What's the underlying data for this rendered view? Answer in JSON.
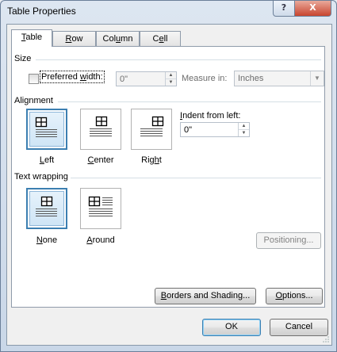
{
  "window": {
    "title": "Table Properties",
    "help_label": "?",
    "close_label": "X"
  },
  "tabs": [
    {
      "label": "Table",
      "mnemonic": "T",
      "rest": "able"
    },
    {
      "label": "Row",
      "mnemonic": "R",
      "rest": "ow"
    },
    {
      "label": "Column",
      "mnemonic": "U",
      "pre": "Col",
      "rest": "mn",
      "u": "u"
    },
    {
      "label": "Cell",
      "mnemonic": "E",
      "pre": "C",
      "u": "e",
      "rest": "ll"
    }
  ],
  "size": {
    "group_label": "Size",
    "preferred_width": {
      "pre": "Preferred ",
      "u": "w",
      "post": "idth:",
      "checked": false
    },
    "width_value": "0\"",
    "measure_label": "Measure in:",
    "measure_value": "Inches"
  },
  "alignment": {
    "group_label": "Alignment",
    "options": [
      {
        "label": "Left",
        "u": "L",
        "rest": "eft",
        "selected": true
      },
      {
        "label": "Center",
        "u": "C",
        "rest": "enter",
        "selected": false
      },
      {
        "label": "Right",
        "pre": "Rig",
        "u": "h",
        "rest": "t",
        "selected": false
      }
    ],
    "indent_label": {
      "u": "I",
      "rest": "ndent from left:"
    },
    "indent_value": "0\""
  },
  "text_wrapping": {
    "group_label": "Text wrapping",
    "options": [
      {
        "label": "None",
        "u": "N",
        "rest": "one",
        "selected": true
      },
      {
        "label": "Around",
        "u": "A",
        "rest": "round",
        "selected": false
      }
    ],
    "positioning_label": "Positioning..."
  },
  "buttons": {
    "borders": {
      "u": "B",
      "rest": "orders and Shading..."
    },
    "options": {
      "u": "O",
      "rest": "ptions..."
    },
    "ok": "OK",
    "cancel": "Cancel"
  }
}
